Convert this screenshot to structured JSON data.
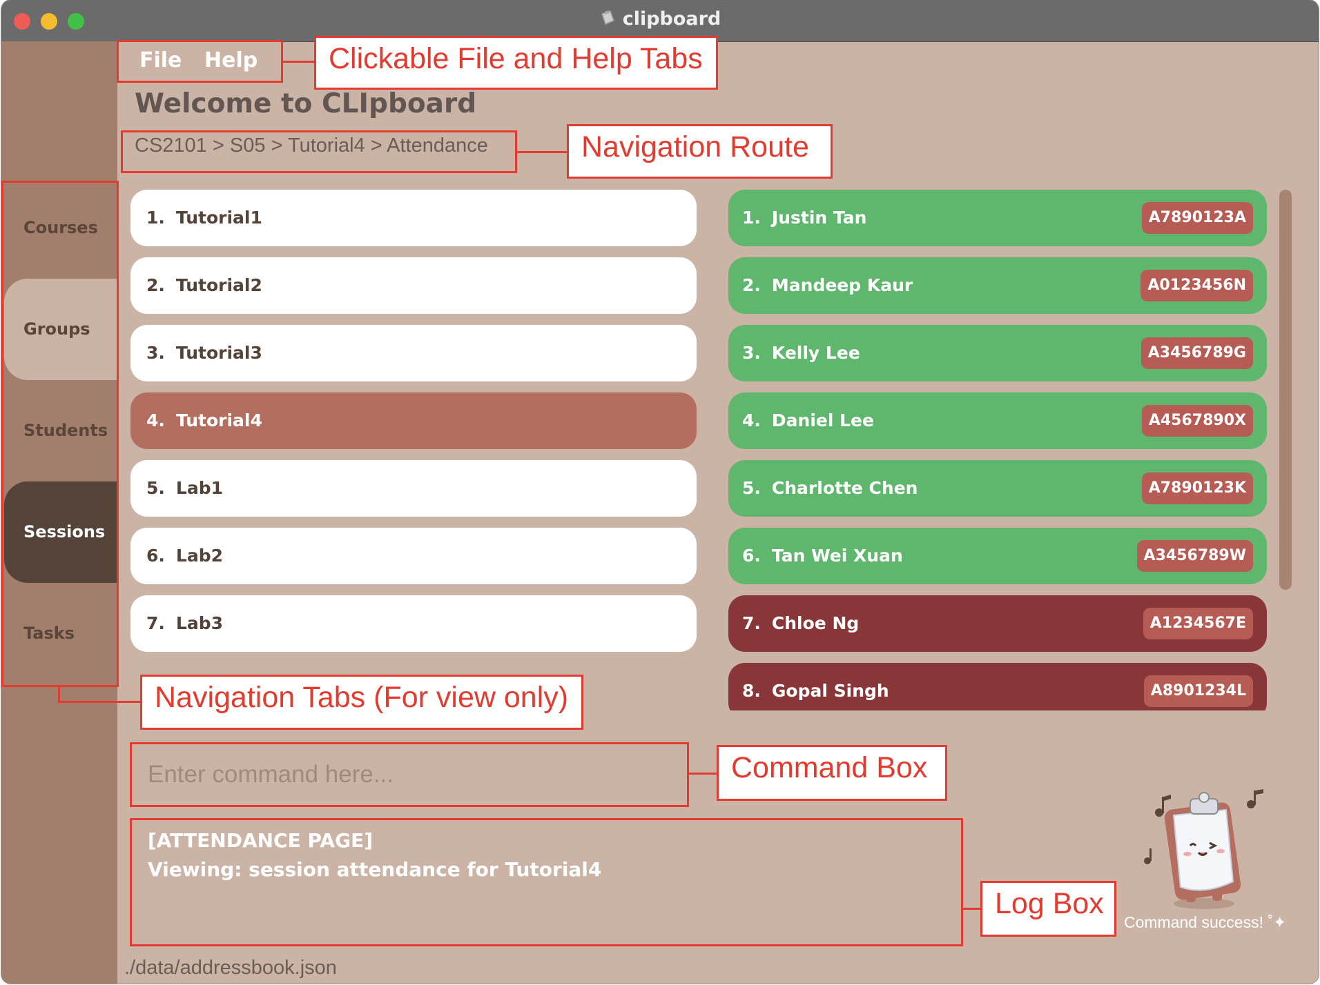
{
  "window": {
    "title": "clipboard",
    "icon": "clipboard-icon"
  },
  "menu": {
    "items": [
      "File",
      "Help"
    ]
  },
  "page": {
    "title": "Welcome to CLIpboard",
    "breadcrumb": "CS2101 > S05 > Tutorial4 > Attendance"
  },
  "sidebar": {
    "tabs": [
      {
        "label": "Courses",
        "state": "inactive"
      },
      {
        "label": "Groups",
        "state": "visited"
      },
      {
        "label": "Students",
        "state": "inactive"
      },
      {
        "label": "Sessions",
        "state": "active"
      },
      {
        "label": "Tasks",
        "state": "inactive"
      }
    ]
  },
  "sessions": [
    {
      "index": "1.",
      "name": "Tutorial1",
      "selected": false
    },
    {
      "index": "2.",
      "name": "Tutorial2",
      "selected": false
    },
    {
      "index": "3.",
      "name": "Tutorial3",
      "selected": false
    },
    {
      "index": "4.",
      "name": "Tutorial4",
      "selected": true
    },
    {
      "index": "5.",
      "name": "Lab1",
      "selected": false
    },
    {
      "index": "6.",
      "name": "Lab2",
      "selected": false
    },
    {
      "index": "7.",
      "name": "Lab3",
      "selected": false
    }
  ],
  "students": [
    {
      "index": "1.",
      "name": "Justin Tan",
      "id": "A7890123A",
      "status": "present"
    },
    {
      "index": "2.",
      "name": "Mandeep Kaur",
      "id": "A0123456N",
      "status": "present"
    },
    {
      "index": "3.",
      "name": "Kelly Lee",
      "id": "A3456789G",
      "status": "present"
    },
    {
      "index": "4.",
      "name": "Daniel Lee",
      "id": "A4567890X",
      "status": "present"
    },
    {
      "index": "5.",
      "name": "Charlotte Chen",
      "id": "A7890123K",
      "status": "present"
    },
    {
      "index": "6.",
      "name": "Tan Wei Xuan",
      "id": "A3456789W",
      "status": "present"
    },
    {
      "index": "7.",
      "name": "Chloe Ng",
      "id": "A1234567E",
      "status": "absent"
    },
    {
      "index": "8.",
      "name": "Gopal Singh",
      "id": "A8901234L",
      "status": "absent"
    }
  ],
  "colors": {
    "present": "#5fb76e",
    "absent": "#893639",
    "selected_session": "#b46e60",
    "annotation": "#e33b30"
  },
  "command": {
    "placeholder": "Enter command here..."
  },
  "log": {
    "lines": [
      "[ATTENDANCE PAGE]",
      "Viewing: session attendance for Tutorial4"
    ]
  },
  "mascot": {
    "status": "Command success!",
    "icon": "clipboard-mascot-icon"
  },
  "status_bar": {
    "path": "./data/addressbook.json"
  },
  "annotations": {
    "file_help": "Clickable File and Help Tabs",
    "route": "Navigation Route",
    "tabs": "Navigation Tabs (For view only)",
    "command": "Command Box",
    "log": "Log Box"
  }
}
